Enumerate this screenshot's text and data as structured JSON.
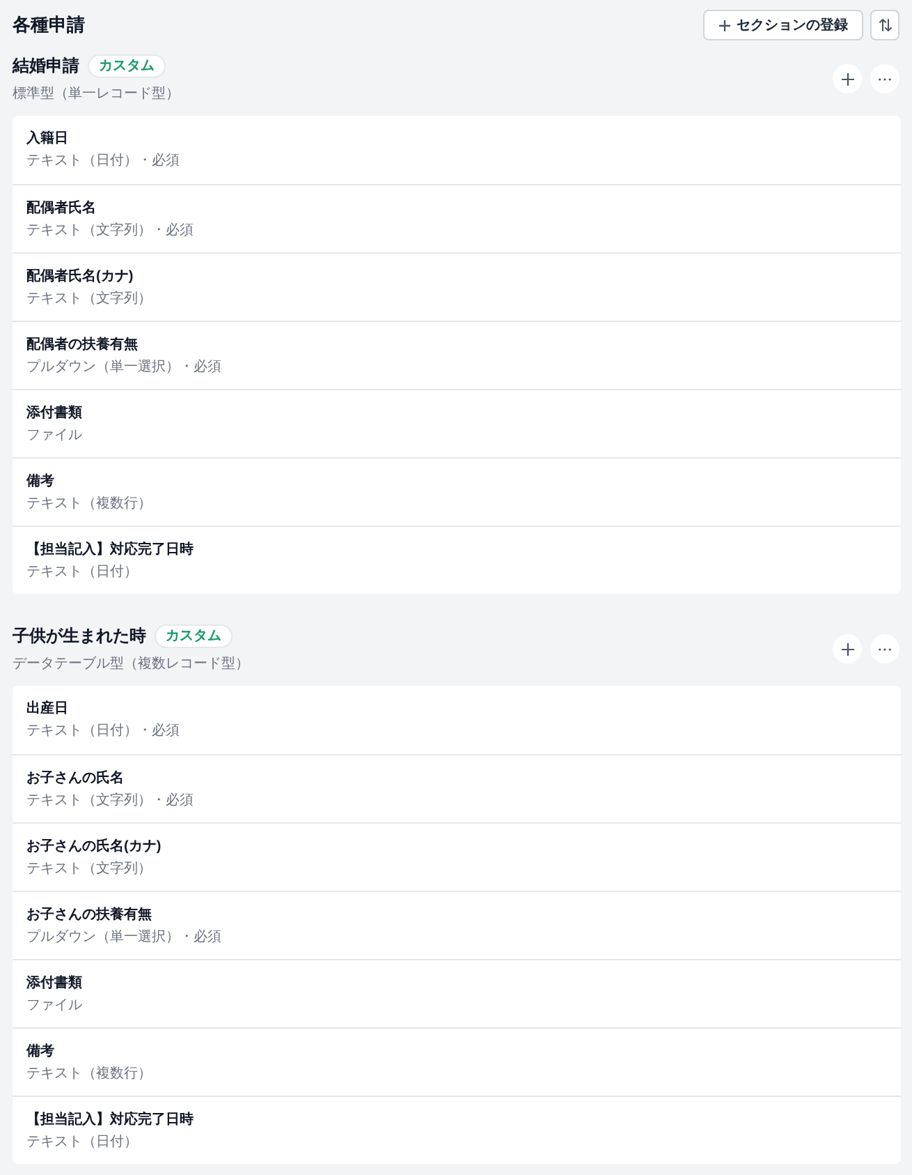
{
  "page": {
    "title": "各種申請",
    "buttons": [
      {
        "kind": "add",
        "label": "セクションの登録"
      },
      {
        "kind": "sort"
      }
    ]
  },
  "sections": [
    {
      "title": "結婚申請",
      "badge": "カスタム",
      "subtitle": "標準型（単一レコード型）",
      "fields": [
        {
          "label": "入籍日",
          "type": "テキスト（日付）・必須"
        },
        {
          "label": "配偶者氏名",
          "type": "テキスト（文字列）・必須"
        },
        {
          "label": "配偶者氏名(カナ)",
          "type": "テキスト（文字列）"
        },
        {
          "label": "配偶者の扶養有無",
          "type": "プルダウン（単一選択）・必須"
        },
        {
          "label": "添付書類",
          "type": "ファイル"
        },
        {
          "label": "備考",
          "type": "テキスト（複数行）"
        },
        {
          "label": "【担当記入】対応完了日時",
          "type": "テキスト（日付）"
        }
      ]
    },
    {
      "title": "子供が生まれた時",
      "badge": "カスタム",
      "subtitle": "データテーブル型（複数レコード型）",
      "fields": [
        {
          "label": "出産日",
          "type": "テキスト（日付）・必須"
        },
        {
          "label": "お子さんの氏名",
          "type": "テキスト（文字列）・必須"
        },
        {
          "label": "お子さんの氏名(カナ)",
          "type": "テキスト（文字列）"
        },
        {
          "label": "お子さんの扶養有無",
          "type": "プルダウン（単一選択）・必須"
        },
        {
          "label": "添付書類",
          "type": "ファイル"
        },
        {
          "label": "備考",
          "type": "テキスト（複数行）"
        },
        {
          "label": "【担当記入】対応完了日時",
          "type": "テキスト（日付）"
        }
      ]
    }
  ]
}
